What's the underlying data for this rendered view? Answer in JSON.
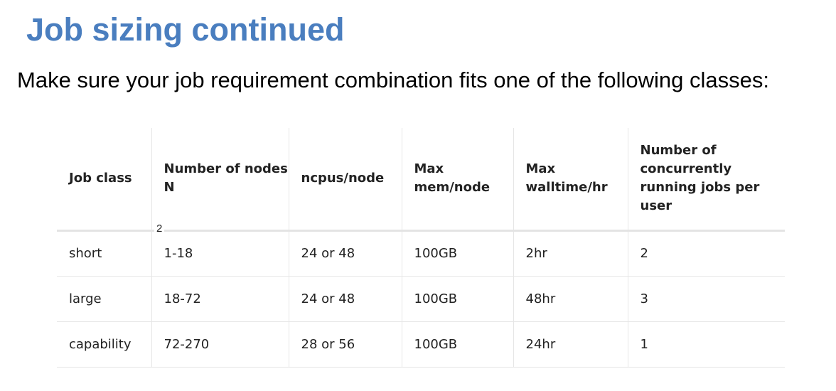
{
  "title": "Job sizing continued",
  "subtitle": "Make sure your job requirement combination fits one of the following classes:",
  "table": {
    "headers": [
      "Job class",
      "Number of nodes N",
      "ncpus/node",
      "Max mem/node",
      "Max walltime/hr",
      "Number of concurrently running jobs per user"
    ],
    "rows": [
      [
        "short",
        "1-18",
        "24 or 48",
        "100GB",
        "2hr",
        "2"
      ],
      [
        "large",
        "18-72",
        "24 or 48",
        "100GB",
        "48hr",
        "3"
      ],
      [
        "capability",
        "72-270",
        "28 or 56",
        "100GB",
        "24hr",
        "1"
      ]
    ],
    "note": "2"
  }
}
